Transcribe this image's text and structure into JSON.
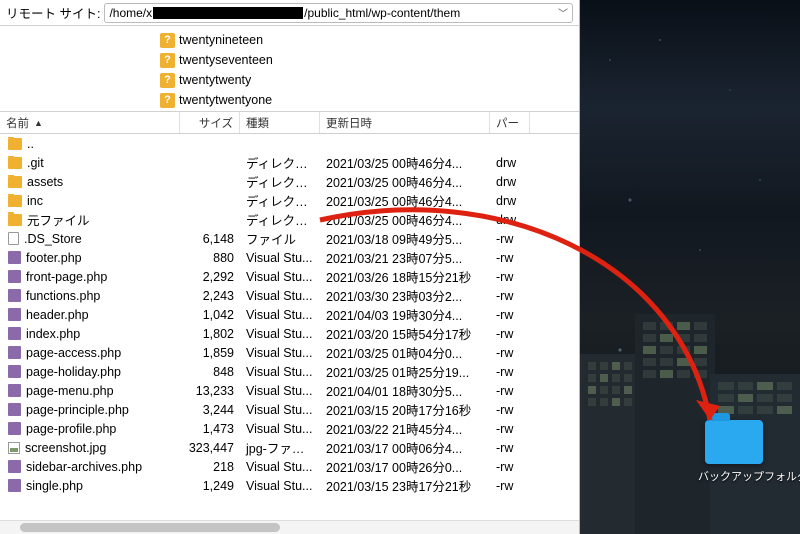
{
  "path_bar": {
    "label": "リモート サイト:",
    "prefix": "/home/x",
    "suffix": "/public_html/wp-content/them"
  },
  "tree": [
    "twentynineteen",
    "twentyseventeen",
    "twentytwenty",
    "twentytwentyone"
  ],
  "columns": {
    "name": "名前",
    "size": "サイズ",
    "type": "種類",
    "date": "更新日時",
    "perm": "パー"
  },
  "files": [
    {
      "icon": "folder",
      "name": "..",
      "size": "",
      "type": "",
      "date": "",
      "perm": ""
    },
    {
      "icon": "folder",
      "name": ".git",
      "size": "",
      "type": "ディレクトリ",
      "date": "2021/03/25 00時46分4...",
      "perm": "drw"
    },
    {
      "icon": "folder",
      "name": "assets",
      "size": "",
      "type": "ディレクトリ",
      "date": "2021/03/25 00時46分4...",
      "perm": "drw"
    },
    {
      "icon": "folder",
      "name": "inc",
      "size": "",
      "type": "ディレクトリ",
      "date": "2021/03/25 00時46分4...",
      "perm": "drw"
    },
    {
      "icon": "folder",
      "name": "元ファイル",
      "size": "",
      "type": "ディレクトリ",
      "date": "2021/03/25 00時46分4...",
      "perm": "drw"
    },
    {
      "icon": "file",
      "name": ".DS_Store",
      "size": "6,148",
      "type": "ファイル",
      "date": "2021/03/18 09時49分5...",
      "perm": "-rw"
    },
    {
      "icon": "php",
      "name": "footer.php",
      "size": "880",
      "type": "Visual Stu...",
      "date": "2021/03/21 23時07分5...",
      "perm": "-rw"
    },
    {
      "icon": "php",
      "name": "front-page.php",
      "size": "2,292",
      "type": "Visual Stu...",
      "date": "2021/03/26 18時15分21秒",
      "perm": "-rw"
    },
    {
      "icon": "php",
      "name": "functions.php",
      "size": "2,243",
      "type": "Visual Stu...",
      "date": "2021/03/30 23時03分2...",
      "perm": "-rw"
    },
    {
      "icon": "php",
      "name": "header.php",
      "size": "1,042",
      "type": "Visual Stu...",
      "date": "2021/04/03 19時30分4...",
      "perm": "-rw"
    },
    {
      "icon": "php",
      "name": "index.php",
      "size": "1,802",
      "type": "Visual Stu...",
      "date": "2021/03/20 15時54分17秒",
      "perm": "-rw"
    },
    {
      "icon": "php",
      "name": "page-access.php",
      "size": "1,859",
      "type": "Visual Stu...",
      "date": "2021/03/25 01時04分0...",
      "perm": "-rw"
    },
    {
      "icon": "php",
      "name": "page-holiday.php",
      "size": "848",
      "type": "Visual Stu...",
      "date": "2021/03/25 01時25分19...",
      "perm": "-rw"
    },
    {
      "icon": "php",
      "name": "page-menu.php",
      "size": "13,233",
      "type": "Visual Stu...",
      "date": "2021/04/01 18時30分5...",
      "perm": "-rw"
    },
    {
      "icon": "php",
      "name": "page-principle.php",
      "size": "3,244",
      "type": "Visual Stu...",
      "date": "2021/03/15 20時17分16秒",
      "perm": "-rw"
    },
    {
      "icon": "php",
      "name": "page-profile.php",
      "size": "1,473",
      "type": "Visual Stu...",
      "date": "2021/03/22 21時45分4...",
      "perm": "-rw"
    },
    {
      "icon": "jpg",
      "name": "screenshot.jpg",
      "size": "323,447",
      "type": "jpg-ファイ...",
      "date": "2021/03/17 00時06分4...",
      "perm": "-rw"
    },
    {
      "icon": "php",
      "name": "sidebar-archives.php",
      "size": "218",
      "type": "Visual Stu...",
      "date": "2021/03/17 00時26分0...",
      "perm": "-rw"
    },
    {
      "icon": "php",
      "name": "single.php",
      "size": "1,249",
      "type": "Visual Stu...",
      "date": "2021/03/15 23時17分21秒",
      "perm": "-rw"
    }
  ],
  "desktop_folder": {
    "label": "バックアップフォルダ"
  },
  "colors": {
    "folder": "#f0b030",
    "accent": "#dd2211",
    "desk_folder": "#2aa8f0"
  }
}
